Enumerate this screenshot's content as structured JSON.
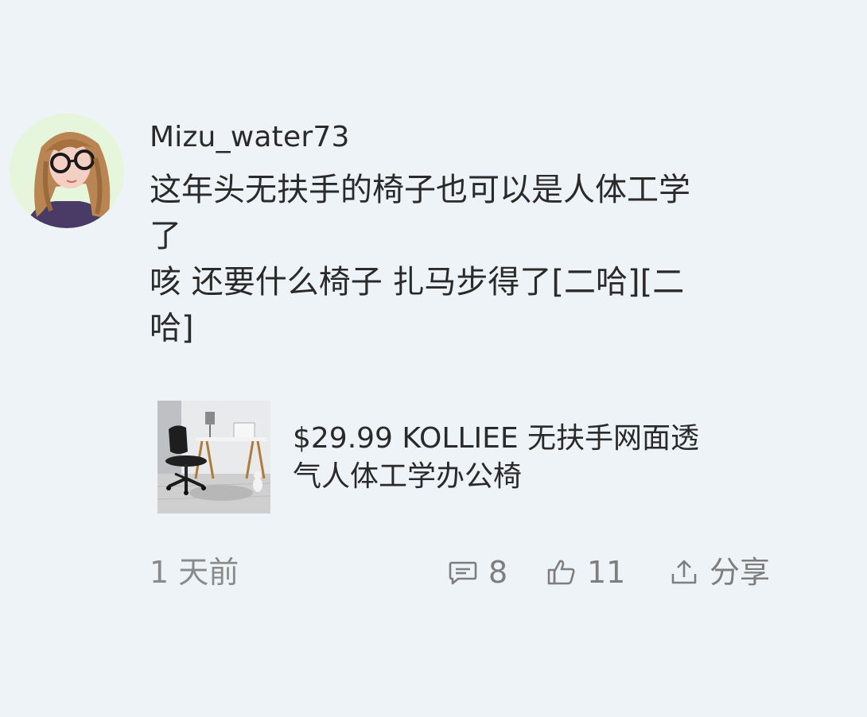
{
  "comment": {
    "username": "Mizu_water73",
    "body_lines": [
      "这年头无扶手的椅子也可以是人体工学",
      "了",
      "咳 还要什么椅子 扎马步得了[二哈][二",
      "哈]"
    ],
    "product": {
      "title_lines": [
        "$29.99 KOLLIEE 无扶手网面透",
        "气人体工学办公椅"
      ],
      "thumbnail_icon": "office-chair-image"
    },
    "timestamp": "1 天前",
    "actions": {
      "reply_icon": "comment-bubble-icon",
      "reply_count": "8",
      "like_icon": "thumbs-up-icon",
      "like_count": "11",
      "share_icon": "share-icon",
      "share_label": "分享"
    }
  },
  "colors": {
    "background": "#edf3f6",
    "text_primary": "#2a2a2a",
    "text_secondary": "#8a8a8a"
  }
}
